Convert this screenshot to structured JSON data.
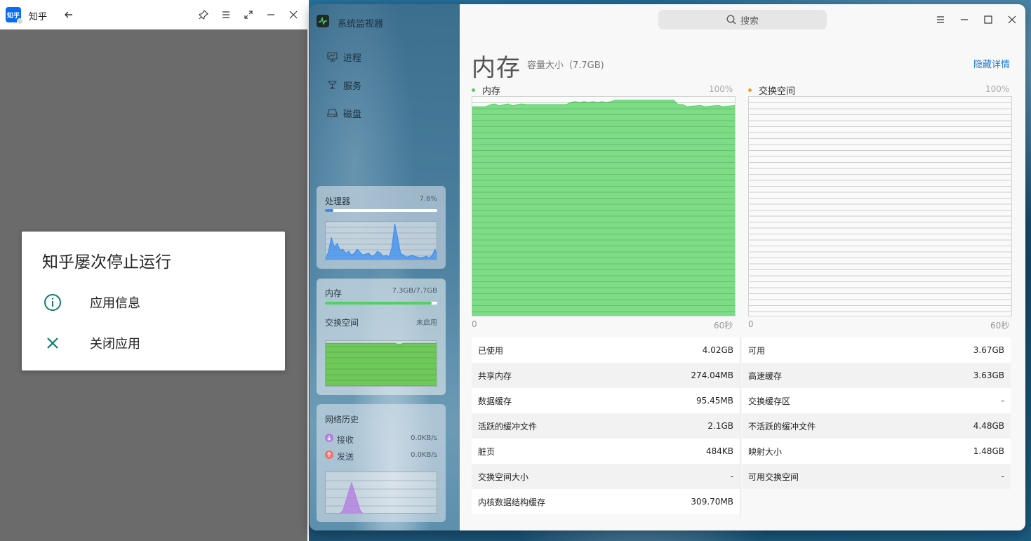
{
  "zhihu": {
    "logo_text": "知乎",
    "title": "知乎",
    "dialog": {
      "title": "知乎屡次停止运行",
      "items": [
        {
          "label": "应用信息",
          "icon": "info-icon"
        },
        {
          "label": "关闭应用",
          "icon": "close-icon"
        }
      ]
    }
  },
  "monitor": {
    "app_title": "系统监视器",
    "search_placeholder": "搜索",
    "nav": [
      {
        "label": "进程",
        "icon": "process-icon"
      },
      {
        "label": "服务",
        "icon": "service-icon"
      },
      {
        "label": "磁盘",
        "icon": "disk-icon"
      }
    ],
    "cpu_card": {
      "title": "处理器",
      "value": "7.6%",
      "percent": 7.6
    },
    "mem_card": {
      "title": "内存",
      "value": "7.3GB/7.7GB",
      "percent": 94.8,
      "swap_title": "交换空间",
      "swap_value": "未启用"
    },
    "net_card": {
      "title": "网络历史",
      "recv_label": "接收",
      "recv_value": "0.0KB/s",
      "send_label": "发送",
      "send_value": "0.0KB/s"
    },
    "main": {
      "title": "内存",
      "subtitle": "容量大小（7.7GB)",
      "hide_details": "隐藏详情",
      "mem_graph": {
        "legend": "内存",
        "max": "100%",
        "x_start": "0",
        "x_end": "60秒"
      },
      "swap_graph": {
        "legend": "交换空间",
        "max": "100%",
        "x_start": "0",
        "x_end": "60秒"
      },
      "left_stats": [
        {
          "label": "已使用",
          "value": "4.02GB"
        },
        {
          "label": "共享内存",
          "value": "274.04MB"
        },
        {
          "label": "数据缓存",
          "value": "95.45MB"
        },
        {
          "label": "活跃的缓冲文件",
          "value": "2.1GB"
        },
        {
          "label": "脏页",
          "value": "484KB"
        },
        {
          "label": "交换空间大小",
          "value": "-"
        },
        {
          "label": "内核数据结构缓存",
          "value": "309.70MB"
        }
      ],
      "right_stats": [
        {
          "label": "可用",
          "value": "3.67GB"
        },
        {
          "label": "高速缓存",
          "value": "3.63GB"
        },
        {
          "label": "交换缓存区",
          "value": "-"
        },
        {
          "label": "不活跃的缓冲文件",
          "value": "4.48GB"
        },
        {
          "label": "映射大小",
          "value": "1.48GB"
        },
        {
          "label": "可用交换空间",
          "value": "-"
        }
      ]
    },
    "colors": {
      "memory": "#52d062",
      "swap": "#f3a020",
      "cpu": "#3a8df0",
      "accent": "#1e7ad8",
      "recv": "#b47ee0",
      "send": "#f07070"
    }
  }
}
